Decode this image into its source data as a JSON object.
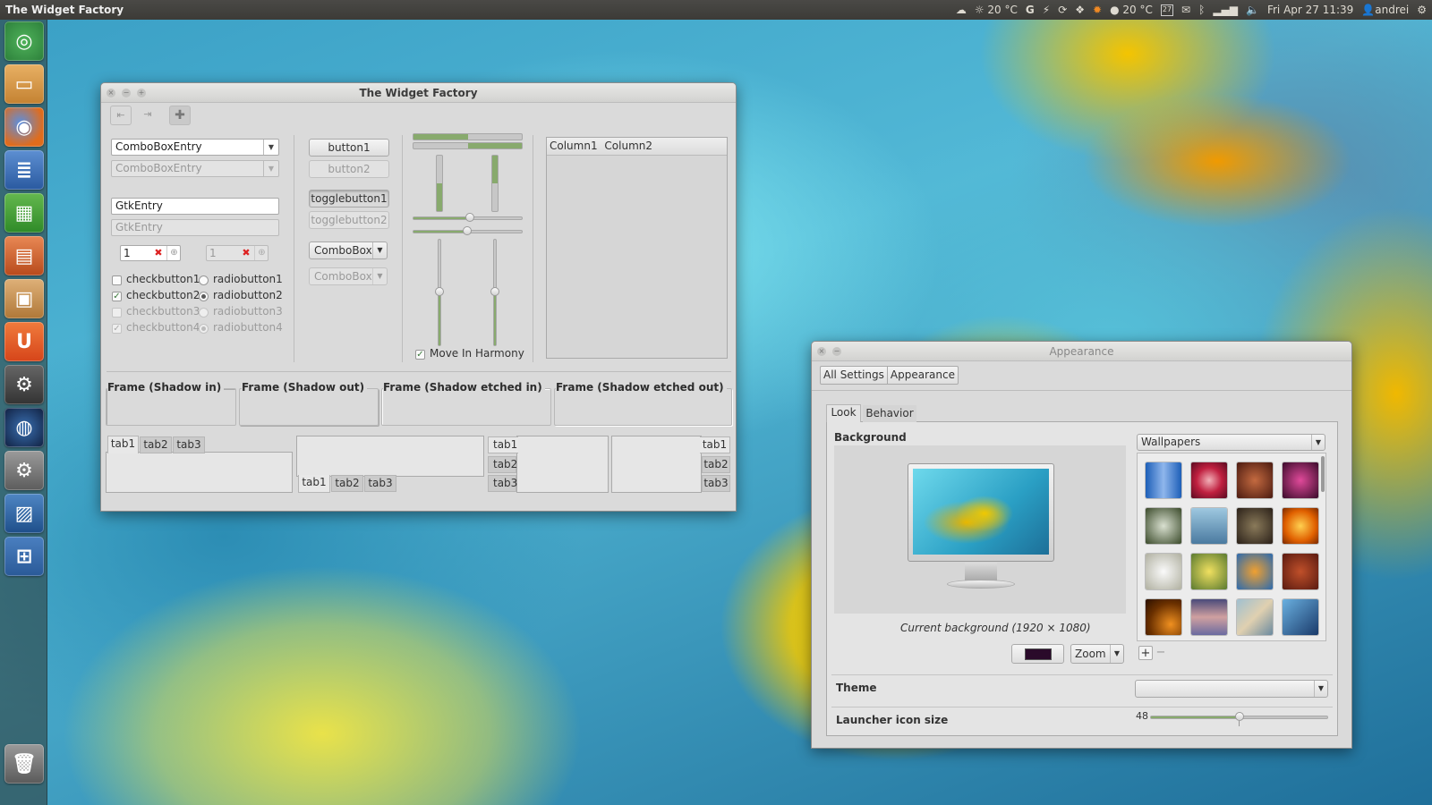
{
  "topbar": {
    "app_title": "The Widget Factory",
    "weather1": "20 °C",
    "weather2": "20 °C",
    "calendar_day": "27",
    "datetime": "Fri Apr 27 11:39",
    "user": "andrei"
  },
  "launcher": {
    "items": [
      "dash",
      "home-folder",
      "firefox",
      "libreoffice-writer",
      "libreoffice-calc",
      "libreoffice-impress",
      "ubuntu-software-center",
      "ubuntu-one",
      "system-tools",
      "globe",
      "system-settings",
      "screenshot",
      "workspace-switcher",
      "trash"
    ]
  },
  "widget_factory": {
    "title": "The Widget Factory",
    "combo_entry1": "ComboBoxEntry",
    "combo_entry2": "ComboBoxEntry",
    "entry1": "GtkEntry",
    "entry2": "GtkEntry",
    "spin1": "1",
    "spin2": "1",
    "checks": [
      "checkbutton1",
      "checkbutton2",
      "checkbutton3",
      "checkbutton4"
    ],
    "radios": [
      "radiobutton1",
      "radiobutton2",
      "radiobutton3",
      "radiobutton4"
    ],
    "button1": "button1",
    "button2": "button2",
    "toggle1": "togglebutton1",
    "toggle2": "togglebutton2",
    "combo1": "ComboBox",
    "combo2": "ComboBox",
    "move_in_harmony": "Move In Harmony",
    "tree_col1": "Column1",
    "tree_col2": "Column2",
    "frames": [
      "Frame (Shadow in)",
      "Frame (Shadow out)",
      "Frame (Shadow etched in)",
      "Frame (Shadow etched out)"
    ],
    "tabs": [
      "tab1",
      "tab2",
      "tab3"
    ]
  },
  "appearance": {
    "title": "Appearance",
    "breadcrumb_all": "All Settings",
    "breadcrumb_current": "Appearance",
    "tab_look": "Look",
    "tab_behavior": "Behavior",
    "background_label": "Background",
    "wallpaper_source": "Wallpapers",
    "current_bg": "Current background (1920 × 1080)",
    "bg_color": "#2a0a2a",
    "zoom": "Zoom",
    "theme_label": "Theme",
    "theme_value": "",
    "launcher_icon_label": "Launcher icon size",
    "launcher_icon_value": "48",
    "launcher_icon_fraction": 0.5,
    "add": "+",
    "remove": "−"
  }
}
